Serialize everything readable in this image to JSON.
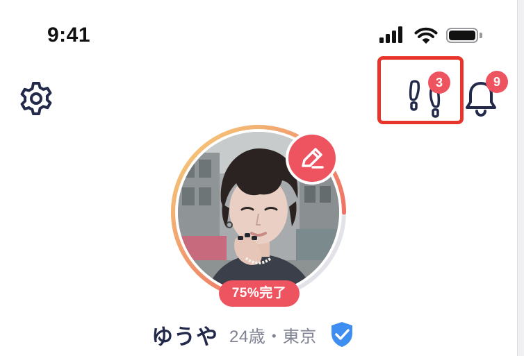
{
  "status_bar": {
    "time": "9:41",
    "signal_icon": "cellular-signal-icon",
    "wifi_icon": "wifi-icon",
    "battery_icon": "battery-icon"
  },
  "header": {
    "settings_icon": "gear-icon",
    "footprints": {
      "icon": "footprints-icon",
      "badge": "3",
      "highlight_color": "#e8352b"
    },
    "notifications": {
      "icon": "bell-icon",
      "badge": "9"
    }
  },
  "profile": {
    "avatar_alt": "profile photo",
    "edit_icon": "pencil-icon",
    "completion_label": "75%完了",
    "completion_fraction": 0.75,
    "name": "ゆうや",
    "age_location": "24歳・東京",
    "verified_icon": "verified-shield-icon"
  },
  "colors": {
    "accent": "#ee5460",
    "navy": "#22294a",
    "muted_text": "#7e8292",
    "ring_gradient": [
      "#f5d27a",
      "#ee5460"
    ],
    "ring_track": "#e2e3e8",
    "verified": "#3d8ef0"
  }
}
